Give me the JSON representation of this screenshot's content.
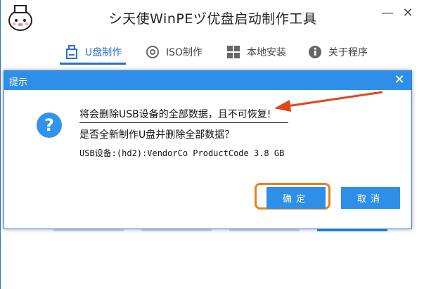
{
  "app": {
    "title": "シ天使WinPEヅ优盘启动制作工具",
    "minimize_glyph": "—",
    "close_glyph": "✕"
  },
  "tabs": [
    {
      "label": "U盘制作",
      "icon": "usb-drive-icon",
      "active": true
    },
    {
      "label": "ISO制作",
      "icon": "disc-icon",
      "active": false
    },
    {
      "label": "本地安装",
      "icon": "windows-logo-icon",
      "active": false
    },
    {
      "label": "关于程序",
      "icon": "info-icon",
      "active": false
    }
  ],
  "dialog": {
    "title": "提示",
    "close_glyph": "✕",
    "icon_glyph": "?",
    "message_warning": "将会删除USB设备的全部数据，且不可恢复!",
    "message_question": "是否全新制作U盘并删除全部数据？",
    "device_info": "USB设备:(hd2):VendorCo ProductCode 3.8 GB",
    "ok_label": "确定",
    "cancel_label": "取消"
  },
  "colors": {
    "accent": "#2f8fe8",
    "annotation": "#e88318",
    "arrow": "#e0451c"
  }
}
